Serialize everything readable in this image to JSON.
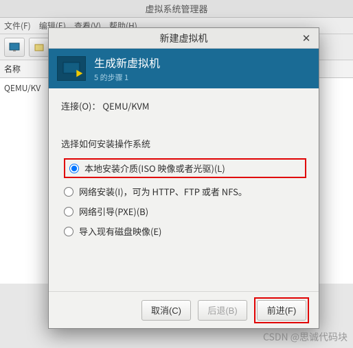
{
  "bg": {
    "title": "虚拟系统管理器",
    "menu": {
      "file": "文件(F)",
      "edit": "编辑(E)",
      "view": "查看(V)",
      "help": "帮助(H)"
    },
    "col_name": "名称",
    "vm": "QEMU/KV"
  },
  "modal": {
    "title": "新建虚拟机",
    "banner_title": "生成新虚拟机",
    "banner_step": "5 的步骤 1",
    "conn_label": "连接(O)：  QEMU/KVM",
    "section": "选择如何安装操作系统",
    "options": [
      "本地安装介质(ISO 映像或者光驱)(L)",
      "网络安装(I)，可为 HTTP、FTP 或者  NFS。",
      "网络引导(PXE)(B)",
      "导入现有磁盘映像(E)"
    ],
    "buttons": {
      "cancel": "取消(C)",
      "back": "后退(B)",
      "forward": "前进(F)"
    }
  },
  "watermark": "CSDN @思诚代码块"
}
